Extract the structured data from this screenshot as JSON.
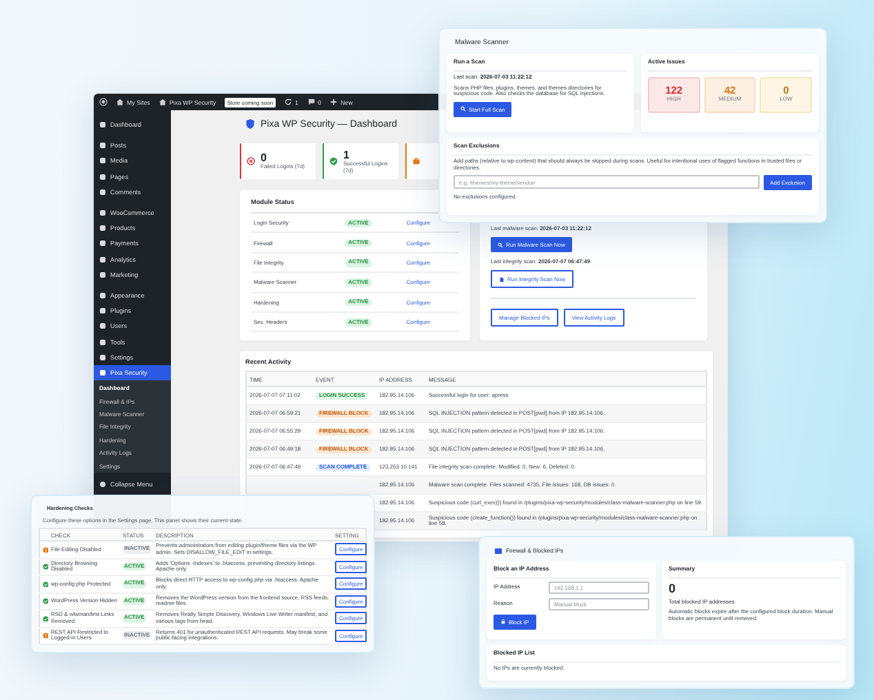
{
  "dashboard_window": {
    "admin_bar": [
      {
        "kind": "logo"
      },
      {
        "kind": "home",
        "label": "My Sites"
      },
      {
        "kind": "home",
        "label": "Pixa WP Security"
      },
      {
        "kind": "badge",
        "label": "Store coming soon"
      },
      {
        "kind": "updates",
        "label": "1"
      },
      {
        "kind": "comments",
        "label": "0"
      },
      {
        "kind": "new",
        "label": "New"
      }
    ],
    "sidebar": {
      "groups": [
        {
          "items": [
            {
              "label": "Dashboard",
              "selected": false
            }
          ]
        },
        {
          "items": [
            {
              "label": "Posts",
              "selected": false
            },
            {
              "label": "Media",
              "selected": false
            },
            {
              "label": "Pages",
              "selected": false
            },
            {
              "label": "Comments",
              "selected": false
            }
          ]
        },
        {
          "items": [
            {
              "label": "WooCommerce",
              "selected": false
            },
            {
              "label": "Products",
              "selected": false
            },
            {
              "label": "Payments",
              "selected": false
            },
            {
              "label": "Analytics",
              "selected": false
            },
            {
              "label": "Marketing",
              "selected": false
            }
          ]
        },
        {
          "items": [
            {
              "label": "Appearance",
              "selected": false
            },
            {
              "label": "Plugins",
              "selected": false
            },
            {
              "label": "Users",
              "selected": false
            },
            {
              "label": "Tools",
              "selected": false
            },
            {
              "label": "Settings",
              "selected": false
            },
            {
              "label": "Pixa Security",
              "selected": true,
              "children": [
                {
                  "label": "Dashboard",
                  "selected": true
                },
                {
                  "label": "Firewall & IPs",
                  "selected": false
                },
                {
                  "label": "Malware Scanner",
                  "selected": false
                },
                {
                  "label": "File Integrity",
                  "selected": false
                },
                {
                  "label": "Hardening",
                  "selected": false
                },
                {
                  "label": "Activity Logs",
                  "selected": false
                },
                {
                  "label": "Settings",
                  "selected": false
                }
              ]
            }
          ]
        }
      ],
      "collapse": "Collapse Menu"
    },
    "title": "Pixa WP Security — Dashboard",
    "stats": [
      {
        "kind": "failed",
        "value": "0",
        "label": "Failed Logins (7d)"
      },
      {
        "kind": "success",
        "value": "1",
        "label": "Successful Logins (7d)"
      },
      {
        "kind": "warning"
      }
    ],
    "module_status": {
      "title": "Module Status",
      "rows": [
        {
          "name": "Login Security",
          "status": "ACTIVE",
          "active": true,
          "link": "Configure"
        },
        {
          "name": "Firewall",
          "status": "ACTIVE",
          "active": true,
          "link": "Configure"
        },
        {
          "name": "File Integrity",
          "status": "ACTIVE",
          "active": true,
          "link": "Configure"
        },
        {
          "name": "Malware Scanner",
          "status": "ACTIVE",
          "active": true,
          "link": "Configure"
        },
        {
          "name": "Hardening",
          "status": "ACTIVE",
          "active": true,
          "link": "Configure"
        },
        {
          "name": "Sec. Headers",
          "status": "ACTIVE",
          "active": true,
          "link": "Configure"
        }
      ]
    },
    "actions": {
      "last_malware_scan": "Last malware scan: **2026-07-03 11:22:12**",
      "malware_button": "Run Malware Scan Now",
      "last_integrity_scan": "Last integrity scan: **2026-07-07 06:47:49**",
      "integrity_button": "Run Integrity Scan Now",
      "buttons": [
        "Manage Blocked IPs",
        "View Activity Logs"
      ]
    },
    "recent_activity": {
      "title": "Recent Activity",
      "columns": [
        "TIME",
        "EVENT",
        "IP ADDRESS",
        "MESSAGE"
      ],
      "rows": [
        {
          "time": "2026-07-07 07:11:02",
          "event": "LOGIN SUCCESS",
          "kind": "login",
          "ip": "182.95.14.106",
          "message": "Successful login for user: apress"
        },
        {
          "time": "2026-07-07 06:59:21",
          "event": "FIREWALL BLOCK",
          "kind": "firewall",
          "ip": "182.95.14.106",
          "message": "SQL INJECTION pattern detected in POST[pwd] from IP 182.95.14.106."
        },
        {
          "time": "2026-07-07 06:55:29",
          "event": "FIREWALL BLOCK",
          "kind": "firewall",
          "ip": "182.95.14.106",
          "message": "SQL INJECTION pattern detected in POST[pwd] from IP 182.95.14.106."
        },
        {
          "time": "2026-07-07 06:49:18",
          "event": "FIREWALL BLOCK",
          "kind": "firewall",
          "ip": "182.95.14.106",
          "message": "SQL INJECTION pattern detected in POST[pwd] from IP 182.95.14.106."
        },
        {
          "time": "2026-07-07 06:47:49",
          "event": "SCAN COMPLETE",
          "kind": "scan",
          "ip": "123.253.10.141",
          "message": "File integrity scan complete. Modified: 0, New: 6, Deleted: 0."
        },
        {
          "ip": "182.95.14.106",
          "message": "Malware scan complete. Files scanned: 4735, File issues: 168, DB issues: 0."
        },
        {
          "ip": "182.95.14.106",
          "message": "Suspicious code (curl_exec()) found in /plugins/pixa-wp-security/modules/class-malware-scanner.php on line 59."
        },
        {
          "ip": "182.95.14.106",
          "message": "Suspicious code (create_function()) found in /plugins/pixa-wp-security/modules/class-malware-scanner.php on line 58."
        }
      ]
    }
  },
  "malware_scanner": {
    "title": "Malware Scanner",
    "run_scan": {
      "title": "Run a Scan",
      "last_scan": "Last scan: **2026-07-03 11:22:12**",
      "description": "Scans PHP files, plugins, themes, and themes directories for suspicious code. Also checks the database for SQL injections.",
      "button": "Start Full Scan"
    },
    "active_issues": {
      "title": "Active Issues",
      "items": [
        {
          "kind": "high",
          "count": "122",
          "label": "HIGH"
        },
        {
          "kind": "medium",
          "count": "42",
          "label": "MEDIUM"
        },
        {
          "kind": "low",
          "count": "0",
          "label": "LOW"
        }
      ]
    },
    "exclusions": {
      "title": "Scan Exclusions",
      "description": "Add paths (relative to wp-content) that should always be skipped during scans. Useful for intentional uses of flagged functions in trusted files or directories.",
      "placeholder": "e.g. /themes/my-theme/vendor/",
      "button": "Add Exclusion",
      "empty": "No exclusions configured."
    }
  },
  "hardening_checks": {
    "title": "Hardening Checks",
    "description": "Configure these options in the Settings page. This panel shows their current state.",
    "columns": [
      "CHECK",
      "STATUS",
      "DESCRIPTION",
      "SETTING"
    ],
    "rows": [
      {
        "check": "File Editing Disabled",
        "status": "INACTIVE",
        "active": false,
        "description": "Prevents administrators from editing plugin/theme files via the WP admin. Sets DISALLOW_FILE_EDIT in settings.",
        "button": "Configure"
      },
      {
        "check": "Directory Browsing Disabled",
        "status": "ACTIVE",
        "active": true,
        "description": "Adds 'Options -Indexes' to .htaccess, preventing directory listings. Apache only.",
        "button": "Configure"
      },
      {
        "check": "wp-config.php Protected",
        "status": "ACTIVE",
        "active": true,
        "description": "Blocks direct HTTP access to wp-config.php via .htaccess. Apache only.",
        "button": "Configure"
      },
      {
        "check": "WordPress Version Hidden",
        "status": "ACTIVE",
        "active": true,
        "description": "Removes the WordPress version from the frontend source, RSS feeds, readme files.",
        "button": "Configure"
      },
      {
        "check": "RSD & wlwmanifest Links Removed",
        "status": "ACTIVE",
        "active": true,
        "description": "Removes Really Simple Discovery, Windows Live Writer manifest, and various tags from head.",
        "button": "Configure"
      },
      {
        "check": "REST API Restricted to Logged-in Users",
        "status": "INACTIVE",
        "active": false,
        "description": "Returns 401 for unauthenticated REST API requests. May break some public-facing integrations.",
        "button": "Configure"
      }
    ]
  },
  "firewall": {
    "title": "Firewall & Blocked IPs",
    "block_form": {
      "title": "Block an IP Address",
      "fields": [
        {
          "label": "IP Address",
          "placeholder": "192.168.1.1"
        },
        {
          "label": "Reason",
          "placeholder": "Manual block"
        }
      ],
      "button": "Block IP"
    },
    "summary": {
      "title": "Summary",
      "count": "0",
      "label": "Total blocked IP addresses",
      "note": "Automatic blocks expire after the configured block duration. Manual blocks are permanent until removed."
    },
    "blocked_list": {
      "title": "Blocked IP List",
      "empty": "No IPs are currently blocked."
    }
  }
}
